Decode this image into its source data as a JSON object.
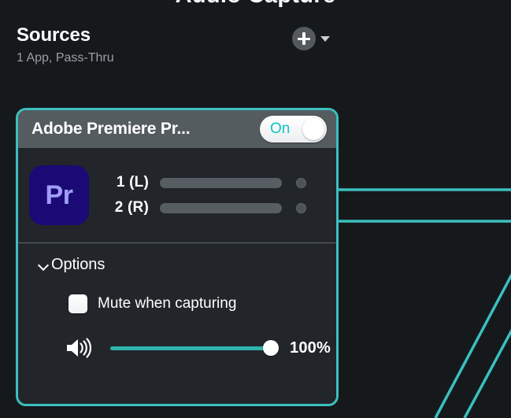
{
  "window": {
    "title_fragment": "Audio Capture"
  },
  "section": {
    "title": "Sources",
    "subtitle": "1 App, Pass-Thru",
    "add_icon": "plus-icon",
    "caret_icon": "chevron-down-icon"
  },
  "source_card": {
    "title": "Adobe Premiere Pr...",
    "app_icon_text": "Pr",
    "app_icon_name": "adobe-premiere-pro-icon",
    "toggle": {
      "label": "On",
      "state": "on"
    },
    "channels": [
      {
        "label": "1 (L)",
        "level": 0
      },
      {
        "label": "2 (R)",
        "level": 0
      }
    ],
    "options": {
      "title": "Options",
      "expanded": true,
      "chevron_icon": "chevron-down-icon",
      "mute_checkbox": {
        "label": "Mute when capturing",
        "checked": false
      },
      "volume": {
        "icon": "speaker-icon",
        "value": "100%",
        "percent": 100
      }
    }
  },
  "colors": {
    "accent_teal": "#3bbfbf",
    "routing_line": "#3bbfbf",
    "toggle_on_text": "#09c7c7",
    "slider_fill": "#2fb3ae",
    "card_header_bg": "#555c60",
    "card_body_bg": "#22262a",
    "page_bg": "#16191c",
    "app_icon_bg": "#1b0a75",
    "app_icon_fg": "#9f9ef7"
  }
}
